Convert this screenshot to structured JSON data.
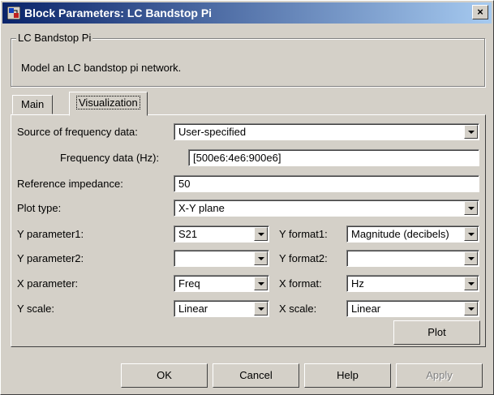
{
  "window": {
    "title": "Block Parameters: LC Bandstop Pi",
    "close_glyph": "×",
    "icon": "simulink-block-icon"
  },
  "block": {
    "group_title": "LC Bandstop Pi",
    "description": "Model an LC bandstop pi network."
  },
  "tabs": [
    {
      "label": "Main",
      "active": false
    },
    {
      "label": "Visualization",
      "active": true
    }
  ],
  "params": {
    "source_label": "Source of frequency data:",
    "source_value": "User-specified",
    "freq_label": "Frequency data (Hz):",
    "freq_value": "[500e6:4e6:900e6]",
    "refimp_label": "Reference impedance:",
    "refimp_value": "50",
    "plottype_label": "Plot type:",
    "plottype_value": "X-Y plane",
    "yparam1_label": "Y parameter1:",
    "yparam1_value": "S21",
    "yformat1_label": "Y format1:",
    "yformat1_value": "Magnitude (decibels)",
    "yparam2_label": "Y parameter2:",
    "yparam2_value": "",
    "yformat2_label": "Y format2:",
    "yformat2_value": "",
    "xparam_label": "X parameter:",
    "xparam_value": "Freq",
    "xformat_label": "X format:",
    "xformat_value": "Hz",
    "yscale_label": "Y scale:",
    "yscale_value": "Linear",
    "xscale_label": "X scale:",
    "xscale_value": "Linear",
    "plot_button": "Plot"
  },
  "buttons": {
    "ok": "OK",
    "cancel": "Cancel",
    "help": "Help",
    "apply": "Apply"
  },
  "colors": {
    "titlebar_start": "#0a246a",
    "titlebar_end": "#a6caf0",
    "face": "#d4d0c8"
  }
}
